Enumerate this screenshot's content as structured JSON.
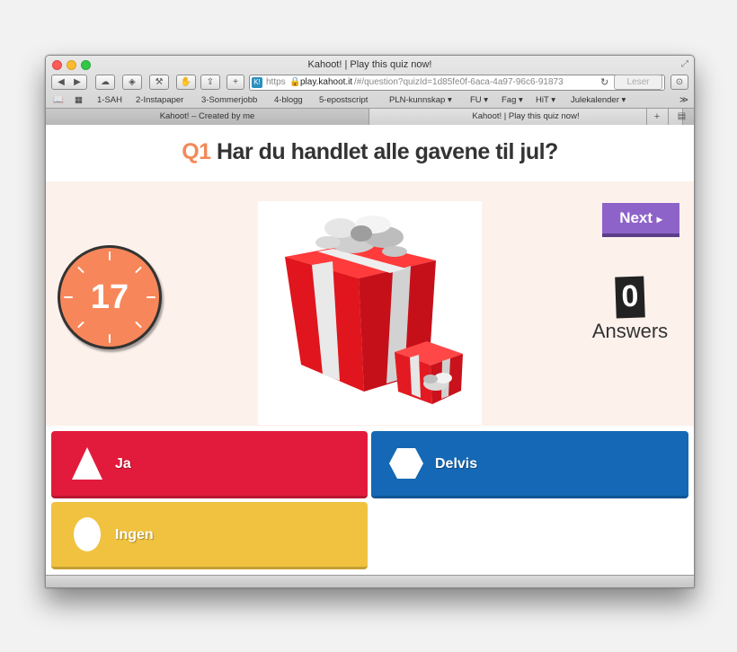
{
  "window": {
    "title": "Kahoot! | Play this quiz now!"
  },
  "toolbar": {
    "back": "◀",
    "forward": "▶",
    "icloud": "☁",
    "layers": "◈",
    "wrench": "⚒",
    "hand": "✋",
    "share": "⇪",
    "add": "+",
    "reader_label": "Leser",
    "download": "⊙"
  },
  "address": {
    "favicon": "K!",
    "protocol": "https",
    "host": "play.kahoot.it",
    "path": "/#/question?quizId=1d85fe0f-6aca-4a97-96c6-91873",
    "reload": "↻"
  },
  "bookmarks": {
    "book": "📖",
    "grid": "▦",
    "items": [
      "1-SAH",
      "2-Instapaper",
      "3-Sommerjobb",
      "4-blogg",
      "5-epostscript",
      "PLN-kunnskap ▾",
      "FU ▾",
      "Fag ▾",
      "HiT ▾",
      "Julekalender ▾"
    ],
    "more": "≫"
  },
  "tabs": [
    {
      "label": "Kahoot! – Created by me"
    },
    {
      "label": "Kahoot! | Play this quiz now!"
    }
  ],
  "tab_add": "+",
  "tab_list": "▤",
  "quiz": {
    "question_number": "Q1",
    "question_text": "Har du handlet alle gavene til jul?",
    "timer": "17",
    "next_label": "Next",
    "next_arrow": "▸",
    "answers_count": "0",
    "answers_label": "Answers",
    "options": [
      {
        "label": "Ja",
        "color": "#e21b3c",
        "shape": "triangle"
      },
      {
        "label": "Delvis",
        "color": "#1468b5",
        "shape": "hexagon"
      },
      {
        "label": "Ingen",
        "color": "#f0c23f",
        "shape": "circle"
      }
    ]
  },
  "colors": {
    "accent_orange": "#f28a5a",
    "next_purple": "#8e63c9",
    "stage_bg": "#fdf1ec"
  }
}
